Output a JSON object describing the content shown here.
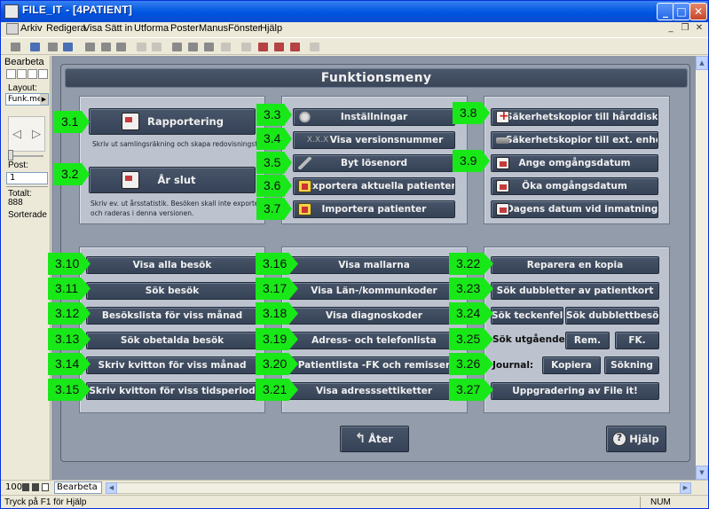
{
  "window": {
    "title": "FILE_IT - [4PATIENT]"
  },
  "menu": [
    "Arkiv",
    "Redigera",
    "Visa",
    "Sätt in",
    "Utforma",
    "Poster",
    "Manus",
    "Fönster",
    "Hjälp"
  ],
  "left_pane": {
    "mode": "Bearbeta",
    "layout_label": "Layout:",
    "layout_value": "Funk.meı",
    "post_label": "Post:",
    "post_value": "1",
    "total_label": "Totalt:",
    "total_value": "888",
    "sorted": "Sorterade"
  },
  "panel_title": "Funktionsmeny",
  "top_left": {
    "rapportering": {
      "label": "Rapportering",
      "desc": "Skriv ut samlingsräkning och skapa redovisningsfil."
    },
    "arslut": {
      "label": "År slut",
      "desc1": "Skriv ev. ut årsstatistik. Besöken skall inte exporteras",
      "desc2": "och raderas i denna versionen."
    }
  },
  "top_middle": [
    "Inställningar",
    "Visa versionsnummer",
    "Byt lösenord",
    "Exportera aktuella patienter",
    "Importera patienter"
  ],
  "top_middle_icons": [
    "gear-icon",
    "version-icon",
    "key-icon",
    "export-icon",
    "import-icon"
  ],
  "version_prefix": "X.X.X",
  "top_right": [
    "Säkerhetskopior till hårddisk",
    "Säkerhetskopior till ext. enhet",
    "Ange omgångsdatum",
    "Öka omgångsdatum",
    "Dagens datum vid inmatning"
  ],
  "top_right_icons": [
    "backup-icon",
    "drive-icon",
    "calendar-icon",
    "calendar-icon",
    "calendar-icon"
  ],
  "bottom_left": [
    "Visa alla besök",
    "Sök besök",
    "Besökslista för viss månad",
    "Sök obetalda besök",
    "Skriv kvitton för viss månad",
    "Skriv kvitton för viss tidsperiod"
  ],
  "bottom_middle": [
    "Visa mallarna",
    "Visa Län-/kommunkoder",
    "Visa diagnoskoder",
    "Adress- och telefonlista",
    "Patientlista -FK och remisser",
    "Visa adresssettiketter"
  ],
  "bottom_right": {
    "reparera": "Reparera en kopia",
    "dubbletter": "Sök dubbletter av patientkort",
    "teckenfel": "Sök teckenfel",
    "dubblettbesok": "Sök dubblettbesök",
    "utgaende_label": "Sök utgående:",
    "rem": "Rem.",
    "fk": "FK.",
    "journal_label": "Journal:",
    "kopiera": "Kopiera",
    "sokning": "Sökning",
    "uppgradering": "Uppgradering av File it!"
  },
  "nav": {
    "back": "Åter",
    "help": "Hjälp"
  },
  "tags": [
    "3.1",
    "3.2",
    "3.3",
    "3.4",
    "3.5",
    "3.6",
    "3.7",
    "3.8",
    "3.9",
    "3.10",
    "3.11",
    "3.12",
    "3.13",
    "3.14",
    "3.15",
    "3.16",
    "3.17",
    "3.18",
    "3.19",
    "3.20",
    "3.21",
    "3.22",
    "3.23",
    "3.24",
    "3.25",
    "3.26",
    "3.27"
  ],
  "bottom_bar": {
    "zoom": "100",
    "mode": "Bearbeta"
  },
  "status": {
    "text": "Tryck på F1 för Hjälp",
    "num": "NUM"
  },
  "colors": {
    "callout": "#18e818",
    "button": "#3f4b5f",
    "box": "#bcc3cf",
    "background": "#8c96a6"
  }
}
